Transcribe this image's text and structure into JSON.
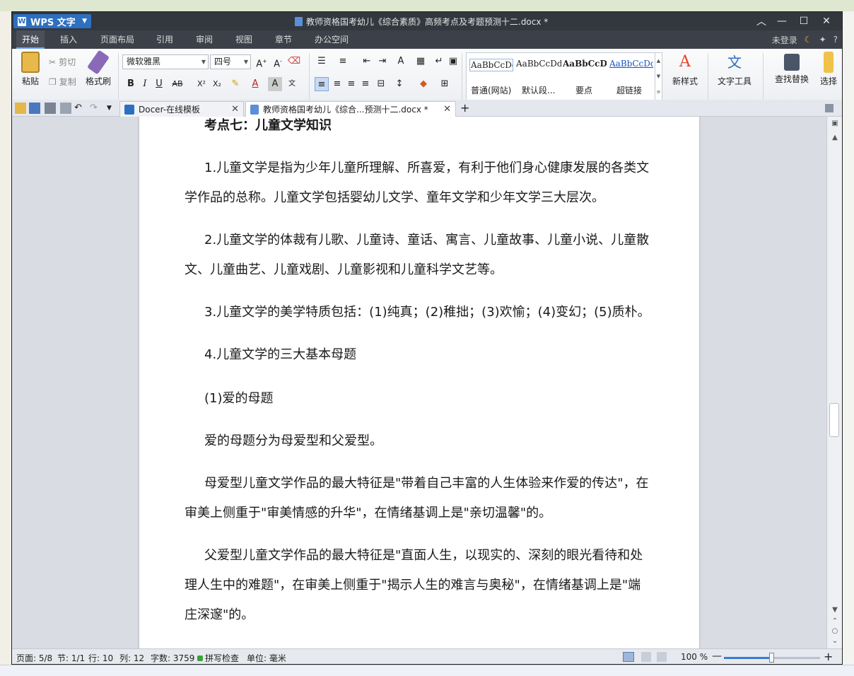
{
  "titlebar": {
    "app_name": "WPS 文字",
    "document_title": "教师资格国考幼儿《综合素质》高频考点及考题预测十二.docx *",
    "controls": [
      "︿",
      "—",
      "☐",
      "✕"
    ]
  },
  "menubar": {
    "items": [
      "开始",
      "插入",
      "页面布局",
      "引用",
      "审阅",
      "视图",
      "章节",
      "办公空间"
    ],
    "active": "开始",
    "login": "未登录",
    "help": "?"
  },
  "ribbon": {
    "paste": "粘贴",
    "cut": "剪切",
    "copy": "复制",
    "format_painter": "格式刷",
    "font_name": "微软雅黑",
    "font_size": "四号",
    "styles": [
      {
        "sample": "AaBbCcDd",
        "name": "普通(网站)"
      },
      {
        "sample": "AaBbCcDd",
        "name": "默认段..."
      },
      {
        "sample": "AaBbCcDd",
        "name": "要点"
      },
      {
        "sample": "AaBbCcDd",
        "name": "超链接"
      }
    ],
    "new_style": "新样式",
    "text_tools": "文字工具",
    "find_replace": "查找替换",
    "select": "选择"
  },
  "tabs": [
    {
      "label": "Docer-在线模板"
    },
    {
      "label": "教师资格国考幼儿《综合...预测十二.docx *"
    }
  ],
  "document": {
    "heading": "考点七：儿童文学知识",
    "paragraphs": [
      "1.儿童文学是指为少年儿童所理解、所喜爱，有利于他们身心健康发展的各类文学作品的总称。儿童文学包括婴幼儿文学、童年文学和少年文学三大层次。",
      "2.儿童文学的体裁有儿歌、儿童诗、童话、寓言、儿童故事、儿童小说、儿童散文、儿童曲艺、儿童戏剧、儿童影视和儿童科学文艺等。",
      "3.儿童文学的美学特质包括：(1)纯真；(2)稚拙；(3)欢愉；(4)变幻；(5)质朴。",
      "4.儿童文学的三大基本母题",
      "(1)爱的母题",
      "爱的母题分为母爱型和父爱型。",
      "母爱型儿童文学作品的最大特征是\"带着自己丰富的人生体验来作爱的传达\"，在审美上侧重于\"审美情感的升华\"，在情绪基调上是\"亲切温馨\"的。",
      "父爱型儿童文学作品的最大特征是\"直面人生，以现实的、深刻的眼光看待和处理人生中的难题\"，在审美上侧重于\"揭示人生的难言与奥秘\"，在情绪基调上是\"端庄深邃\"的。"
    ]
  },
  "statusbar": {
    "page": "页面: 5/8",
    "section": "节: 1/1",
    "line": "行: 10",
    "column": "列: 12",
    "word_count": "字数: 3759",
    "spell_check": "拼写检查",
    "unit": "单位: 毫米",
    "zoom": "100 %",
    "zoom_level": 0.5
  },
  "colors": {
    "titlebar": "#33383f",
    "accent": "#2d6fc0",
    "page": "#ffffff"
  }
}
